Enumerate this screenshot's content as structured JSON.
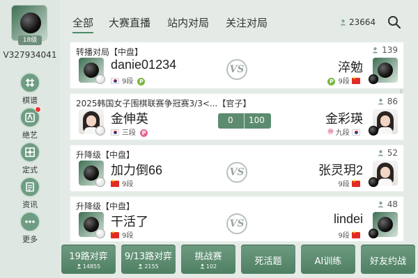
{
  "sidebar": {
    "level": "18级",
    "user_id": "V327934041",
    "items": [
      {
        "label": "棋谱",
        "icon": "board-icon"
      },
      {
        "label": "绝艺",
        "icon": "ai-icon",
        "has_notification": true
      },
      {
        "label": "定式",
        "icon": "pattern-icon"
      },
      {
        "label": "资讯",
        "icon": "news-icon"
      },
      {
        "label": "更多",
        "icon": "more-icon"
      }
    ]
  },
  "header": {
    "tabs": [
      {
        "label": "全部",
        "active": true
      },
      {
        "label": "大赛直播",
        "active": false
      },
      {
        "label": "站内对局",
        "active": false
      },
      {
        "label": "关注对局",
        "active": false
      }
    ],
    "online_count": "23664"
  },
  "games": [
    {
      "title": "转播对局【中盘】",
      "viewers": "139",
      "left": {
        "name": "danie01234",
        "rank": "9段",
        "flag": "kr",
        "stone": "white",
        "badge": "P"
      },
      "right": {
        "name": "淬勉",
        "rank": "9段",
        "flag": "cn",
        "stone": "black",
        "badge": "P"
      },
      "center": "VS"
    },
    {
      "title": "2025韩国女子围棋联赛争冠赛3/3<...【官子】",
      "viewers": "86",
      "left": {
        "name": "金伸英",
        "rank": "三段",
        "flag": "kr",
        "stone": "white",
        "badge": "P"
      },
      "right": {
        "name": "金彩瑛",
        "rank": "九段",
        "flag": "kr",
        "stone": "black",
        "badge": ""
      },
      "score_left": "0",
      "score_right": "100"
    },
    {
      "title": "升降级【中盘】",
      "viewers": "52",
      "left": {
        "name": "加力倒66",
        "rank": "9段",
        "flag": "cn",
        "stone": "white"
      },
      "right": {
        "name": "张灵玥2",
        "rank": "9段",
        "flag": "cn",
        "stone": "black"
      },
      "center": "VS"
    },
    {
      "title": "升降级【中盘】",
      "viewers": "48",
      "left": {
        "name": "干活了",
        "rank": "9段",
        "flag": "cn",
        "stone": "white"
      },
      "right": {
        "name": "lindei",
        "rank": "9段",
        "flag": "cn",
        "stone": "black"
      },
      "center": "VS"
    }
  ],
  "bottom_buttons": [
    {
      "label": "19路对弈",
      "count": "14855"
    },
    {
      "label": "9/13路对弈",
      "count": "2155"
    },
    {
      "label": "挑战赛",
      "count": "102"
    },
    {
      "label": "死活题",
      "count": ""
    },
    {
      "label": "AI训练",
      "count": ""
    },
    {
      "label": "好友约战",
      "count": ""
    }
  ],
  "colors": {
    "accent": "#4f7f63",
    "background": "#e4ebe6",
    "card": "#ffffff"
  }
}
